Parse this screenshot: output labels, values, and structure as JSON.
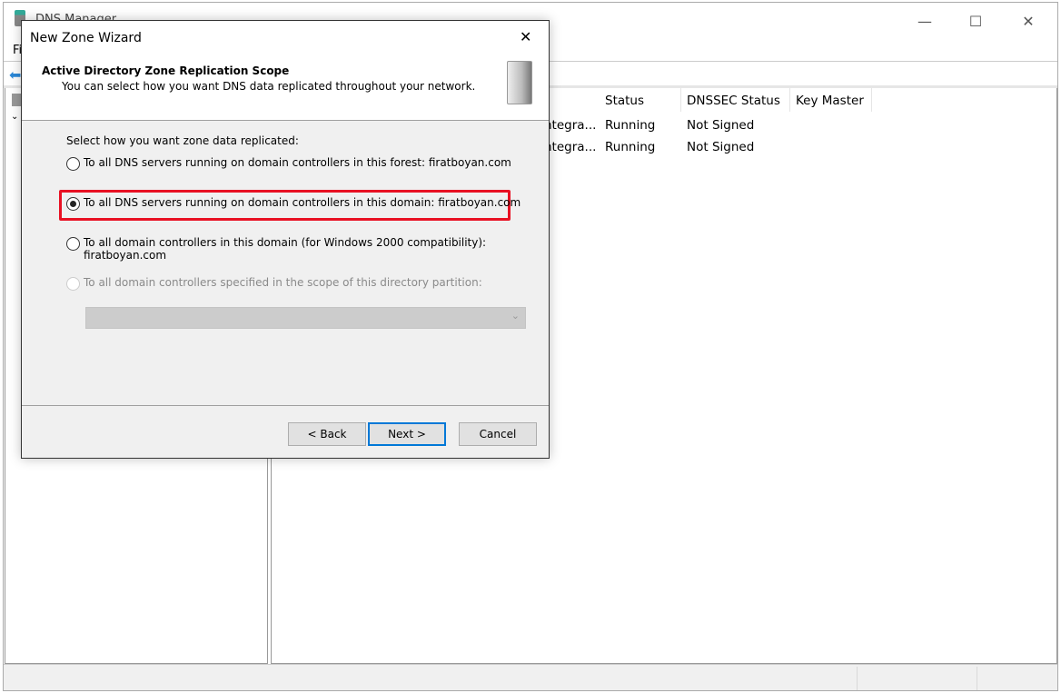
{
  "window": {
    "title": "DNS Manager",
    "menu_first": "Fi",
    "minimize": "—",
    "maximize": "☐",
    "close": "✕"
  },
  "list": {
    "columns": [
      "Status",
      "DNSSEC Status",
      "Key Master"
    ],
    "rows": [
      {
        "type": "ntegra...",
        "status": "Running",
        "dnssec": "Not Signed"
      },
      {
        "type": "ntegra...",
        "status": "Running",
        "dnssec": "Not Signed"
      }
    ]
  },
  "dialog": {
    "title": "New Zone Wizard",
    "close": "✕",
    "heading": "Active Directory Zone Replication Scope",
    "subheading": "You can select how you want DNS data replicated throughout your network.",
    "prompt": "Select how you want zone data replicated:",
    "options": [
      {
        "label": "To all DNS servers running on domain controllers in this forest: firatboyan.com",
        "selected": false,
        "enabled": true
      },
      {
        "label": "To all DNS servers running on domain controllers in this domain: firatboyan.com",
        "selected": true,
        "enabled": true
      },
      {
        "label": "To all domain controllers in this domain (for Windows 2000 compatibility):",
        "label2": "firatboyan.com",
        "selected": false,
        "enabled": true
      },
      {
        "label": "To all domain controllers specified in the scope of this directory partition:",
        "selected": false,
        "enabled": false
      }
    ],
    "partition_select": "",
    "back": "< Back",
    "next": "Next >",
    "cancel": "Cancel",
    "highlight_color": "#e81123"
  }
}
